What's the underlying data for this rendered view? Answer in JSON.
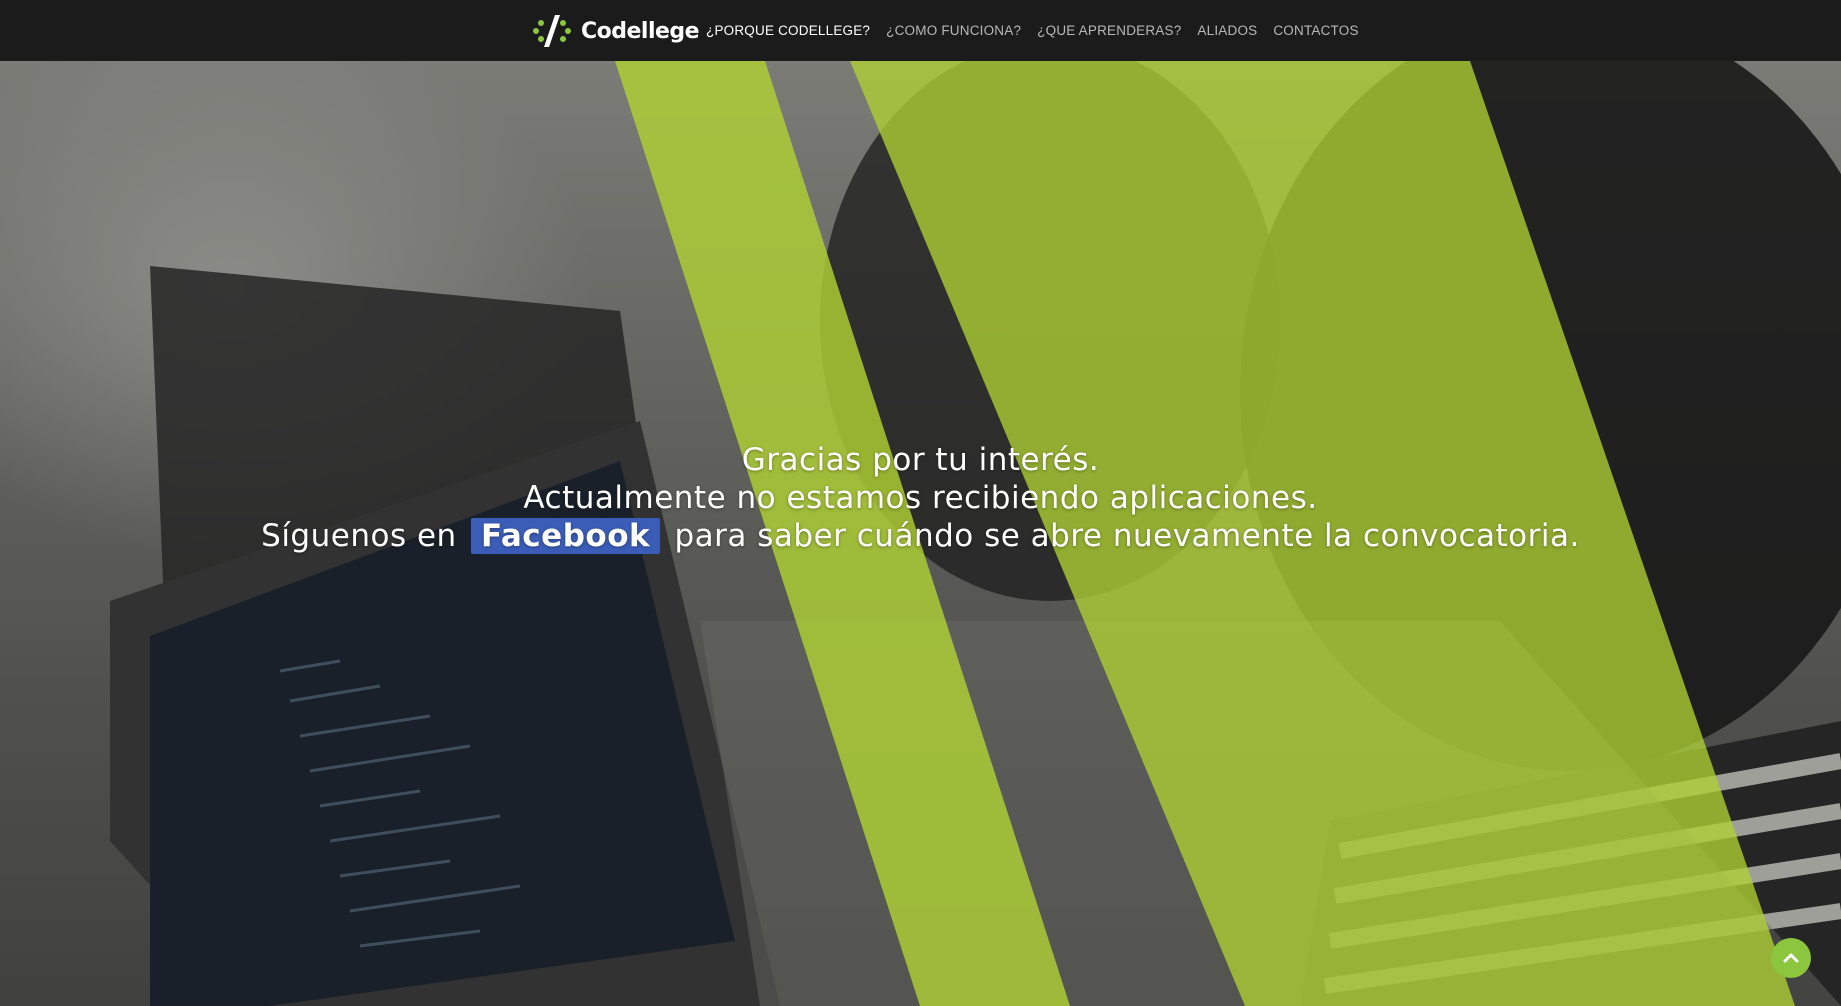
{
  "brand": {
    "name": "Codellege",
    "logo_icon": "code-slash-icon",
    "accent_color": "#8cc63f"
  },
  "nav": {
    "items": [
      {
        "label": "¿PORQUE CODELLEGE?",
        "active": true
      },
      {
        "label": "¿COMO FUNCIONA?",
        "active": false
      },
      {
        "label": "¿QUE APRENDERAS?",
        "active": false
      },
      {
        "label": "ALIADOS",
        "active": false
      },
      {
        "label": "CONTACTOS",
        "active": false
      }
    ]
  },
  "hero": {
    "line1": "Gracias por tu interés.",
    "line2": "Actualmente no estamos recibiendo aplicaciones.",
    "line3_prefix": "Síguenos en",
    "facebook_label": "Facebook",
    "line3_suffix": "para saber cuándo se abre nuevamente la convocatoria.",
    "facebook_color": "#3b5db8",
    "overlay_color": "#c8ee3c",
    "background_image": "people-coding-on-laptops-photo"
  },
  "scroll_top": {
    "icon": "chevron-up-icon",
    "color": "#8cc63f"
  }
}
